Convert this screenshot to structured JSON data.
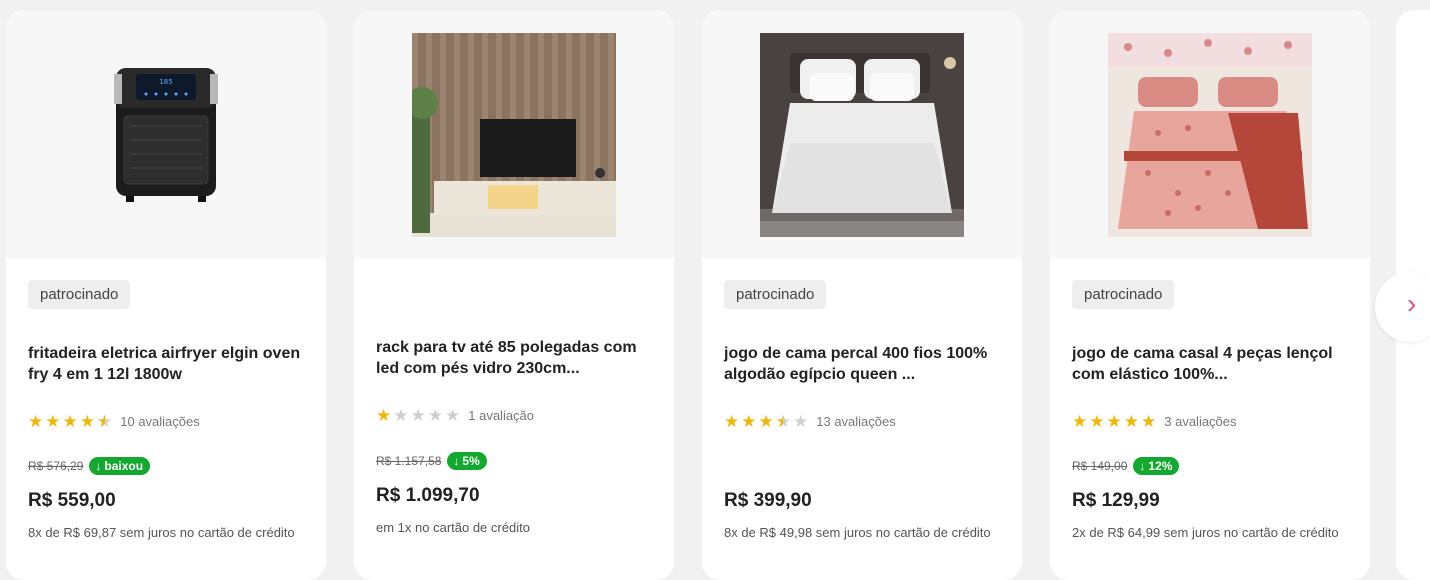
{
  "products": [
    {
      "badge": "patrocinado",
      "title": "fritadeira eletrica airfryer elgin oven fry 4 em 1 12l 1800w",
      "rating_count": "10 avaliações",
      "old_price": "R$ 576,29",
      "discount_label": "baixou",
      "price": "R$ 559,00",
      "installments": "8x de R$ 69,87 sem juros no cartão de crédito",
      "image_icon": "airfryer-image",
      "stars": 4.5
    },
    {
      "badge": "",
      "title": "rack para tv até 85 polegadas com led com pés vidro 230cm...",
      "rating_count": "1 avaliação",
      "old_price": "R$ 1.157,58",
      "discount_label": "5%",
      "price": "R$ 1.099,70",
      "installments": "em 1x no cartão de crédito",
      "image_icon": "tv-rack-image",
      "stars": 1
    },
    {
      "badge": "patrocinado",
      "title": "jogo de cama percal 400 fios 100% algodão egípcio queen ...",
      "rating_count": "13 avaliações",
      "old_price": "",
      "discount_label": "",
      "price": "R$ 399,90",
      "installments": "8x de R$ 49,98 sem juros no cartão de crédito",
      "image_icon": "white-bedding-image",
      "stars": 3.5
    },
    {
      "badge": "patrocinado",
      "title": "jogo de cama casal 4 peças lençol com elástico 100%...",
      "rating_count": "3 avaliações",
      "old_price": "R$ 149,00",
      "discount_label": "12%",
      "price": "R$ 129,99",
      "installments": "2x de R$ 64,99 sem juros no cartão de crédito",
      "image_icon": "floral-bedding-image",
      "stars": 5
    }
  ],
  "navigation": {
    "next_icon": "chevron-right-icon"
  },
  "colors": {
    "discount_green": "#13a82f",
    "star_yellow": "#f2b705",
    "accent_pink": "#e84c7a"
  }
}
